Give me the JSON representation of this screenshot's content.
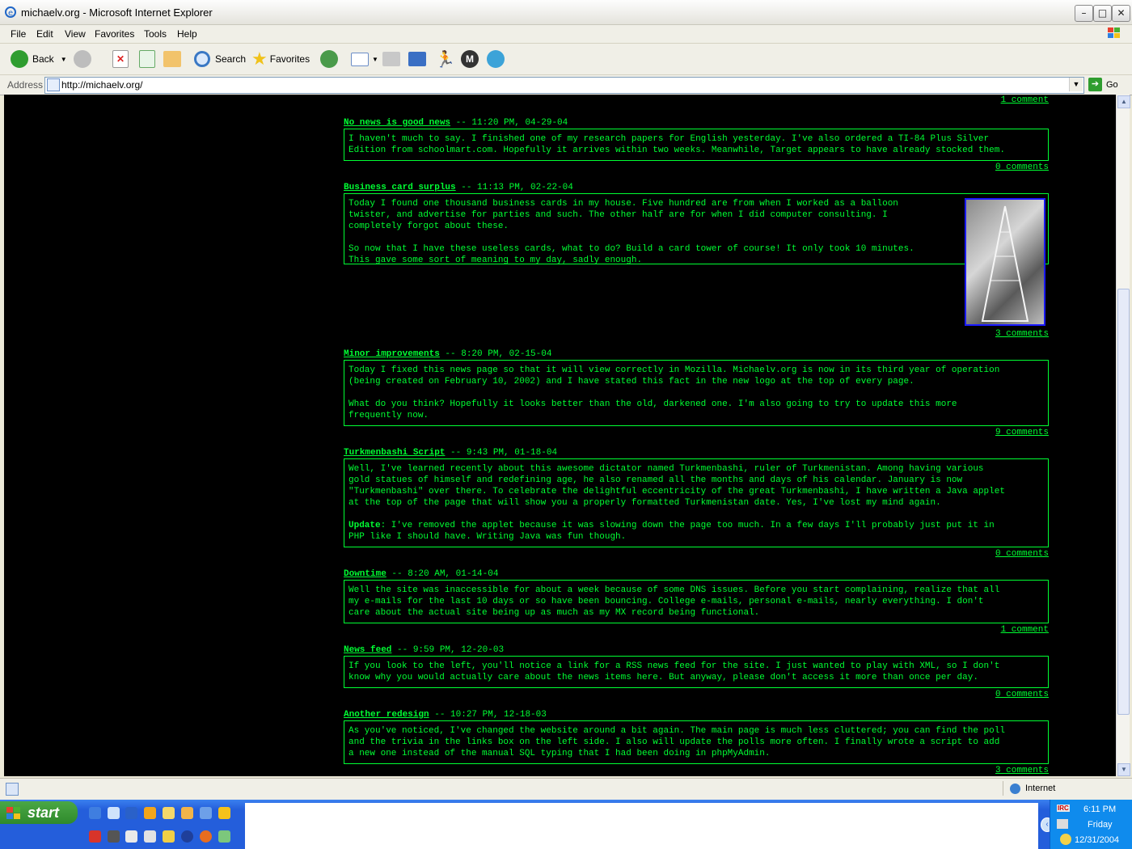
{
  "window": {
    "title": "michaelv.org - Microsoft Internet Explorer"
  },
  "menu": [
    "File",
    "Edit",
    "View",
    "Favorites",
    "Tools",
    "Help"
  ],
  "toolbar": {
    "back": "Back",
    "search": "Search",
    "favorites": "Favorites",
    "go": "Go"
  },
  "address": {
    "label": "Address",
    "url": "http://michaelv.org/"
  },
  "top_comment": "1 comment",
  "posts": [
    {
      "title": "No news is good news",
      "meta": " -- 11:20 PM, 04-29-04",
      "body": "I haven't much to say. I finished one of my research papers for English yesterday. I've also ordered a TI-84 Plus Silver\nEdition from schoolmart.com. Hopefully it arrives within two weeks. Meanwhile, Target appears to have already stocked them.",
      "comments": "0 comments"
    },
    {
      "title": "Business card surplus",
      "meta": " -- 11:13 PM, 02-22-04",
      "body": "Today I found one thousand business cards in my house. Five hundred are from when I worked as a balloon\ntwister, and advertise for parties and such. The other half are for when I did computer consulting. I\ncompletely forgot about these.\n\nSo now that I have these useless cards, what to do? Build a card tower of course! It only took 10 minutes.\nThis gave some sort of meaning to my day, sadly enough.",
      "comments": "3 comments"
    },
    {
      "title": "Minor improvements",
      "meta": " -- 8:20 PM, 02-15-04",
      "body": "Today I fixed this news page so that it will view correctly in Mozilla. Michaelv.org is now in its third year of operation\n(being created on February 10, 2002) and I have stated this fact in the new logo at the top of every page.\n\nWhat do you think? Hopefully it looks better than the old, darkened one. I'm also going to try to update this more\nfrequently now.",
      "comments": "9 comments"
    },
    {
      "title": "Turkmenbashi Script",
      "meta": " -- 9:43 PM, 01-18-04",
      "body": "Well, I've learned recently about this awesome dictator named Turkmenbashi, ruler of Turkmenistan. Among having various\ngold statues of himself and redefining age, he also renamed all the months and days of his calendar. January is now\n\"Turkmenbashi\" over there. To celebrate the delightful eccentricity of the great Turkmenbashi, I have written a Java applet\nat the top of the page that will show you a properly formatted Turkmenistan date. Yes, I've lost my mind again.\n\n",
      "update_label": "Update",
      "update_text": ": I've removed the applet because it was slowing down the page too much. In a few days I'll probably just put it in\nPHP like I should have. Writing Java was fun though.",
      "comments": "0 comments"
    },
    {
      "title": "Downtime",
      "meta": " -- 8:20 AM, 01-14-04",
      "body": "Well the site was inaccessible for about a week because of some DNS issues. Before you start complaining, realize that all\nmy e-mails for the last 10 days or so have been bouncing. College e-mails, personal e-mails, nearly everything. I don't\ncare about the actual site being up as much as my MX record being functional.",
      "comments": "1 comment"
    },
    {
      "title": "News feed",
      "meta": " -- 9:59 PM, 12-20-03",
      "body": "If you look to the left, you'll notice a link for a RSS news feed for the site. I just wanted to play with XML, so I don't\nknow why you would actually care about the news items here. But anyway, please don't access it more than once per day.",
      "comments": "0 comments"
    },
    {
      "title": "Another redesign",
      "meta": " -- 10:27 PM, 12-18-03",
      "body": "As you've noticed, I've changed the website around a bit again. The main page is much less cluttered; you can find the poll\nand the trivia in the links box on the left side. I also will update the polls more often. I finally wrote a script to add\na new one instead of the manual SQL typing that I had been doing in phpMyAdmin.",
      "comments": "3 comments"
    }
  ],
  "status": {
    "zone": "Internet"
  },
  "taskbar": {
    "start": "start",
    "clock_time": "6:11 PM",
    "clock_day": "Friday",
    "clock_date": "12/31/2004",
    "irc1": "IRC",
    "irc2": "IRC"
  }
}
